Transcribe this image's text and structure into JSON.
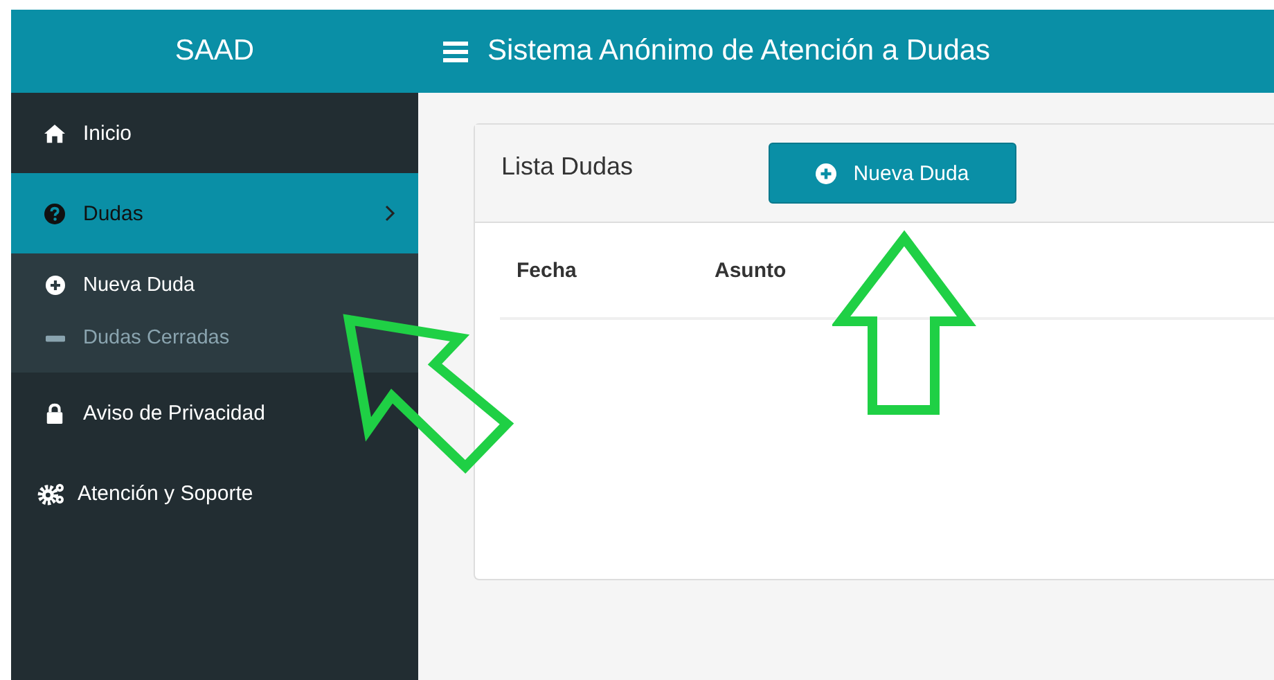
{
  "header": {
    "logo": "SAAD",
    "title": "Sistema Anónimo de Atención a Dudas"
  },
  "sidebar": {
    "items": [
      {
        "kind": "home",
        "label": "Inicio",
        "selected": false
      },
      {
        "kind": "question",
        "label": "Dudas",
        "selected": true,
        "expanded": true,
        "children": [
          {
            "kind": "plus",
            "label": "Nueva Duda",
            "selected": true
          },
          {
            "kind": "minus",
            "label": "Dudas Cerradas",
            "selected": false
          }
        ]
      },
      {
        "kind": "lock",
        "label": "Aviso de Privacidad",
        "selected": false
      },
      {
        "kind": "cogs",
        "label": "Atención y Soporte",
        "selected": false
      }
    ]
  },
  "card": {
    "title": "Lista Dudas",
    "button": "Nueva Duda",
    "table": {
      "columns": [
        "Fecha",
        "Asunto"
      ]
    }
  },
  "annotations": [
    {
      "kind": "arrow-up"
    },
    {
      "kind": "arrow-diagonal"
    }
  ]
}
